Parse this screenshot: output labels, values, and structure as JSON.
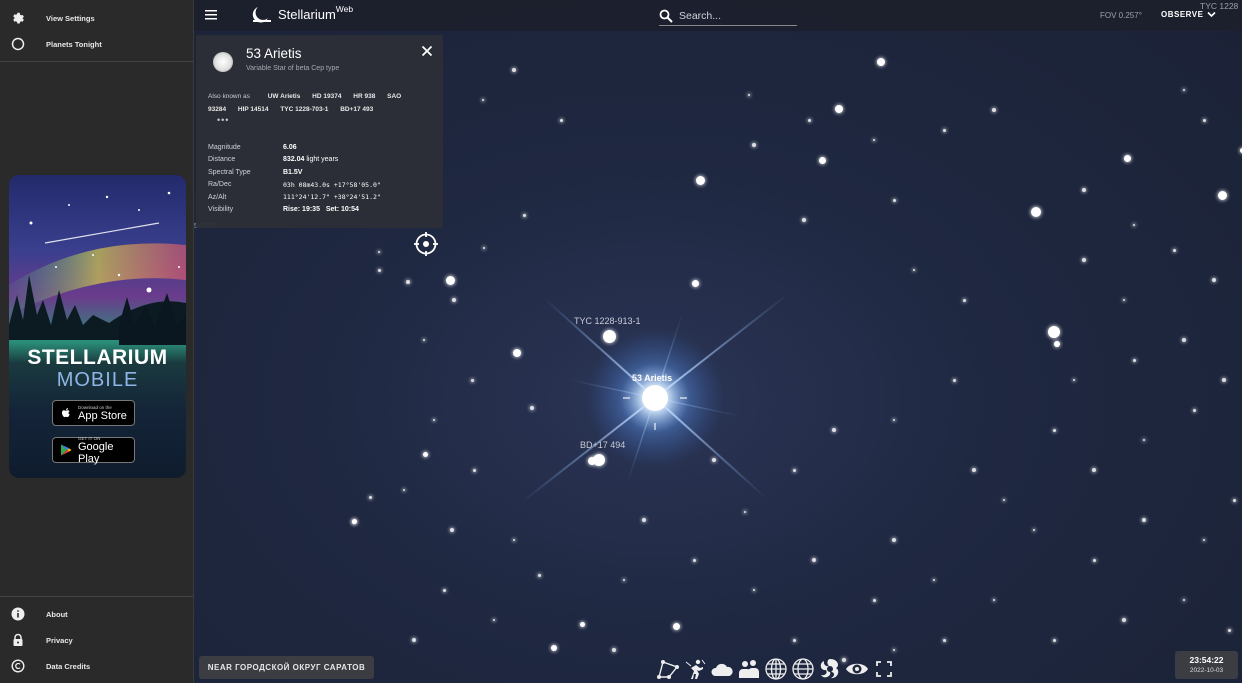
{
  "sidebar": {
    "top_items": [
      {
        "label": "View Settings",
        "icon": "gear-icon"
      },
      {
        "label": "Planets Tonight",
        "icon": "circle-outline-icon"
      }
    ],
    "promo": {
      "title": "STELLARIUM",
      "subtitle": "MOBILE",
      "app_store": {
        "small": "Download on the",
        "big": "App Store"
      },
      "google_play": {
        "small": "GET IT ON",
        "big": "Google Play"
      }
    },
    "bottom_items": [
      {
        "label": "About",
        "icon": "info-icon"
      },
      {
        "label": "Privacy",
        "icon": "lock-icon"
      },
      {
        "label": "Data Credits",
        "icon": "copyright-icon"
      }
    ]
  },
  "topbar": {
    "brand_name": "Stellarium",
    "brand_sup": "Web",
    "search_placeholder": "Search...",
    "fov": "FOV 0.257°",
    "observe_label": "OBSERVE",
    "corner_label": "TYC 1228"
  },
  "info_panel": {
    "name": "53 Arietis",
    "type": "Variable Star of beta Cep type",
    "aka_label": "Also known as",
    "designations": [
      "UW Arietis",
      "HD 19374",
      "HR 938",
      "SAO 93284",
      "HIP 14514",
      "TYC 1228-703-1",
      "BD+17 493"
    ],
    "more": "•••",
    "magnitude_label": "Magnitude",
    "magnitude": "6.06",
    "distance_label": "Distance",
    "distance_value": "832.04",
    "distance_unit": " light years",
    "spectral_label": "Spectral Type",
    "spectral": "B1.5V",
    "radec_label": "Ra/Dec",
    "radec": "03h 08m43.0s  +17°58'05.0\"",
    "azalt_label": "Az/Alt",
    "azalt": "111°24'12.7\"  +38°24'51.2\"",
    "visibility_label": "Visibility",
    "rise": "Rise: 19:35",
    "set": "Set: 10:54"
  },
  "partial_id": "548297",
  "sky_labels": {
    "star_a": "TYC 1228-913-1",
    "star_main": "53 Arietis",
    "star_b": "BD+17 494"
  },
  "location": "NEAR ГОРОДСКОЙ ОКРУГ САРАТОВ",
  "toolbar": [
    "constellation-lines-icon",
    "constellation-art-icon",
    "atmosphere-icon",
    "landscape-icon",
    "azimuthal-grid-icon",
    "equatorial-grid-icon",
    "deep-sky-icon",
    "night-mode-icon",
    "fullscreen-icon"
  ],
  "clock": {
    "time": "23:54:22",
    "date": "2022-10-03"
  }
}
